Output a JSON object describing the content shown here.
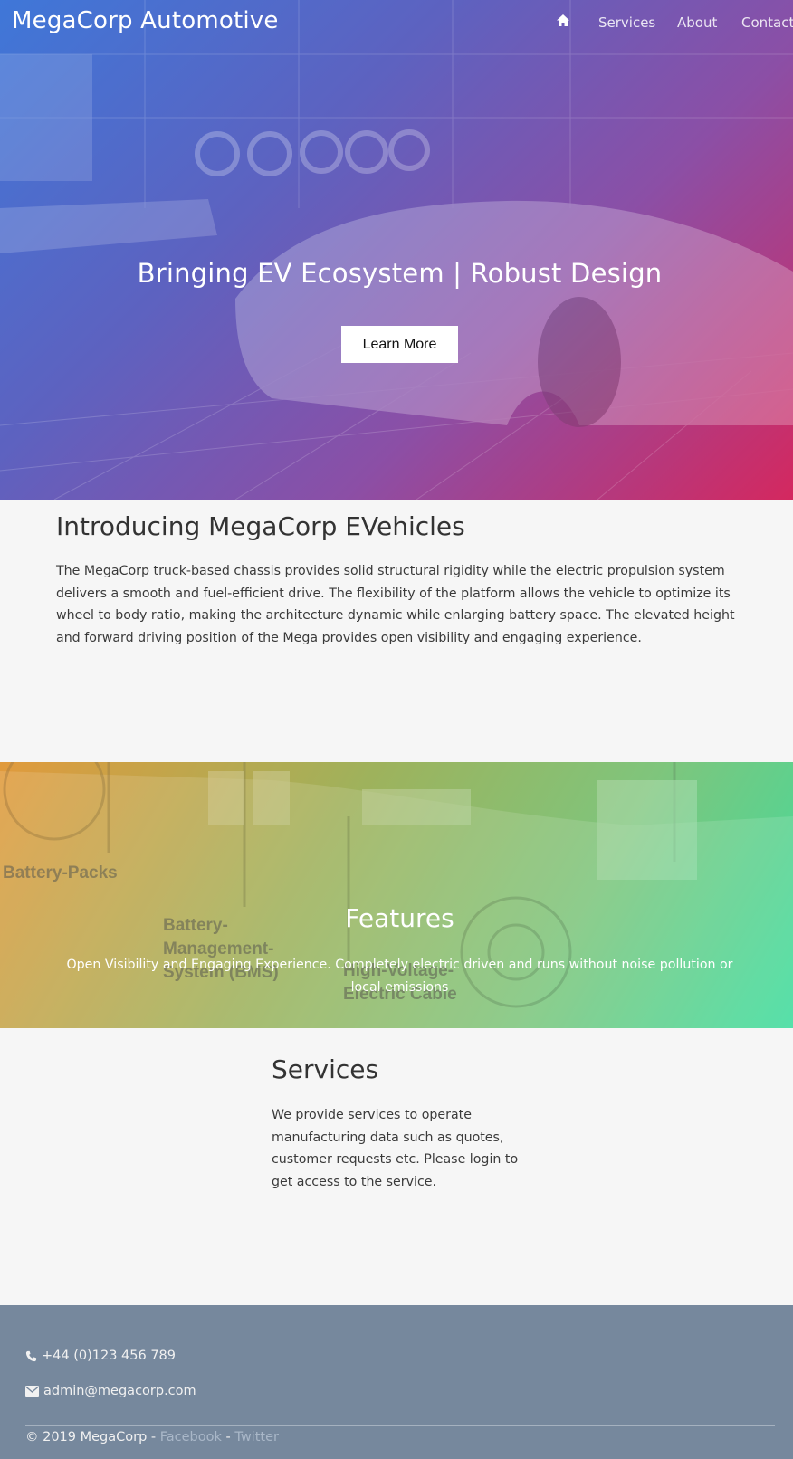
{
  "nav": {
    "brand": "MegaCorp Automotive",
    "home_icon": "home-icon",
    "links": [
      "Services",
      "About",
      "Contact"
    ]
  },
  "hero": {
    "title": "Bringing EV Ecosystem | Robust Design",
    "button_label": "Learn More",
    "gradient": [
      "#3f77d8",
      "#8b4fa6",
      "#d4285f"
    ]
  },
  "intro": {
    "heading": "Introducing MegaCorp EVehicles",
    "body": "The MegaCorp truck-based chassis provides solid structural rigidity while the electric propulsion system delivers a smooth and fuel-efficient drive. The flexibility of the platform allows the vehicle to optimize its wheel to body ratio, making the architecture dynamic while enlarging battery space. The elevated height and forward driving position of the Mega provides open visibility and engaging experience."
  },
  "features": {
    "heading": "Features",
    "body": "Open Visibility and Engaging Experience. Completely electric driven and runs without noise pollution or local emissions",
    "diagram_labels": [
      "Battery-Packs",
      "Battery-Management-System (BMS)",
      "High-Voltage-Electric Cable"
    ],
    "gradient": [
      "#e19a3c",
      "#7fc57c",
      "#3fdc9e"
    ]
  },
  "services": {
    "heading": "Services",
    "body": "We provide services to operate manufacturing data such as quotes, customer requests etc. Please login to get access to the service."
  },
  "footer": {
    "phone_icon": "phone-icon",
    "phone": "+44 (0)123 456 789",
    "email_icon": "envelope-icon",
    "email": "admin@megacorp.com",
    "copyright": "© 2019 MegaCorp - ",
    "facebook": "Facebook",
    "separator": " - ",
    "twitter": "Twitter",
    "background": "#76889d"
  }
}
